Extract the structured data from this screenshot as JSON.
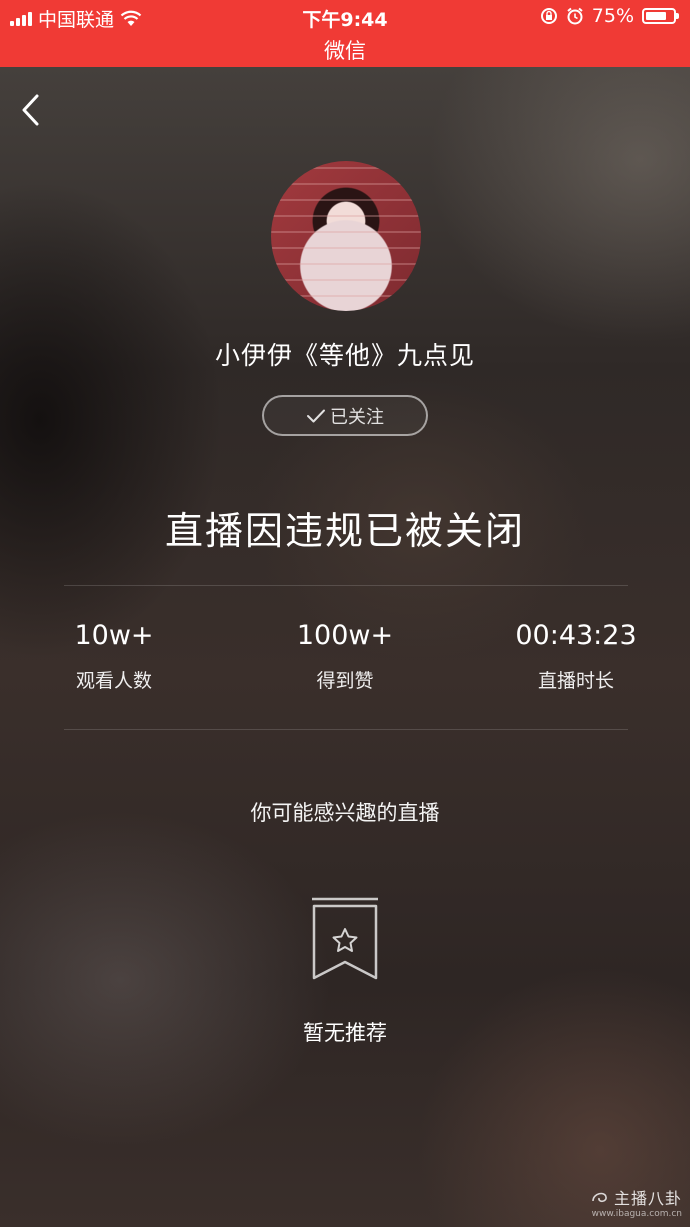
{
  "status_bar": {
    "carrier": "中国联通",
    "time": "下午9:44",
    "battery_percent": "75%",
    "battery_level": 0.75,
    "icons": [
      "signal-icon",
      "wifi-icon",
      "rotation-lock-icon",
      "alarm-icon",
      "battery-icon"
    ]
  },
  "title_bar": {
    "title": "微信",
    "color": "#f03a35"
  },
  "nav": {
    "back_icon": "chevron-left-icon"
  },
  "streamer": {
    "name": "小伊伊《等他》九点见",
    "follow_label": "已关注",
    "follow_icon": "checkmark-icon"
  },
  "headline": "直播因违规已被关闭",
  "stats": [
    {
      "value": "10w+",
      "label": "观看人数"
    },
    {
      "value": "100w+",
      "label": "得到赞"
    },
    {
      "value": "00:43:23",
      "label": "直播时长"
    }
  ],
  "recommendations": {
    "title": "你可能感兴趣的直播",
    "empty_icon": "bookmark-star-icon",
    "empty_text": "暂无推荐"
  },
  "watermark": {
    "main": "主播八卦",
    "sub": "www.ibagua.com.cn"
  }
}
